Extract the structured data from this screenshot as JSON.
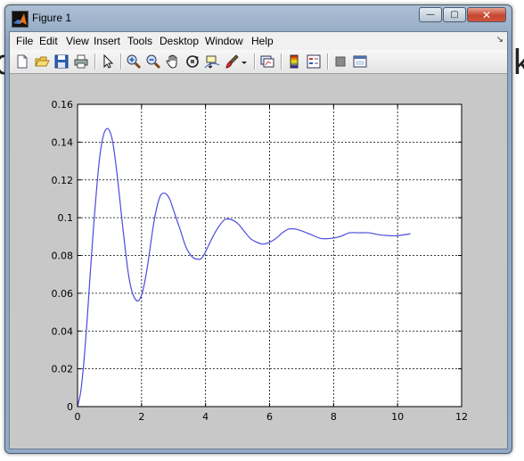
{
  "background": {
    "left_glyph": "c",
    "right_glyph": "k"
  },
  "window": {
    "title": "Figure 1",
    "controls": {
      "minimize": "—",
      "maximize": "▢",
      "close": "✕"
    }
  },
  "menu": [
    {
      "label": "File"
    },
    {
      "label": "Edit"
    },
    {
      "label": "View"
    },
    {
      "label": "Insert"
    },
    {
      "label": "Tools"
    },
    {
      "label": "Desktop"
    },
    {
      "label": "Window"
    },
    {
      "label": "Help"
    }
  ],
  "menu_arrow": "↘",
  "toolbar_icons": [
    "new-figure-icon",
    "open-file-icon",
    "save-icon",
    "print-icon",
    "edit-plot-arrow-icon",
    "zoom-in-icon",
    "zoom-out-icon",
    "pan-hand-icon",
    "rotate-3d-icon",
    "data-cursor-icon",
    "brush-icon",
    "brush-dropdown-icon",
    "link-plot-icon",
    "colorbar-icon",
    "legend-icon",
    "hide-plot-tools-icon",
    "show-plot-tools-icon"
  ],
  "colors": {
    "line": "#4b4bdc",
    "axes_bg": "#ffffff",
    "figure_bg": "#c8c8c8",
    "grid": "#000000"
  },
  "chart_data": {
    "type": "line",
    "title": "",
    "xlabel": "",
    "ylabel": "",
    "xlim": [
      0,
      12
    ],
    "ylim": [
      0,
      0.16
    ],
    "xticks": [
      0,
      2,
      4,
      6,
      8,
      10,
      12
    ],
    "yticks": [
      0,
      0.02,
      0.04,
      0.06,
      0.08,
      0.1,
      0.12,
      0.14,
      0.16
    ],
    "xtick_labels": [
      "0",
      "2",
      "4",
      "6",
      "8",
      "10",
      "12"
    ],
    "ytick_labels": [
      "0",
      "0.02",
      "0.04",
      "0.06",
      "0.08",
      "0.1",
      "0.12",
      "0.14",
      "0.16"
    ],
    "grid": true,
    "grid_style": "dotted",
    "series": [
      {
        "x": [
          0,
          0.1,
          0.2,
          0.3,
          0.4,
          0.5,
          0.6,
          0.7,
          0.8,
          0.9,
          1.0,
          1.1,
          1.2,
          1.3,
          1.4,
          1.5,
          1.6,
          1.7,
          1.8,
          1.9,
          2.0,
          2.1,
          2.2,
          2.3,
          2.4,
          2.5,
          2.6,
          2.7,
          2.8,
          2.9,
          3.0,
          3.2,
          3.4,
          3.6,
          3.8,
          3.9,
          4.0,
          4.2,
          4.4,
          4.6,
          4.8,
          5.0,
          5.2,
          5.4,
          5.6,
          5.8,
          6.0,
          6.2,
          6.4,
          6.6,
          6.8,
          7.0,
          7.3,
          7.6,
          7.9,
          8.2,
          8.5,
          8.8,
          9.1,
          9.4,
          9.7,
          10.0,
          10.4
        ],
        "y": [
          0,
          0.008,
          0.024,
          0.046,
          0.071,
          0.095,
          0.116,
          0.133,
          0.143,
          0.147,
          0.146,
          0.14,
          0.128,
          0.113,
          0.097,
          0.082,
          0.069,
          0.061,
          0.057,
          0.056,
          0.059,
          0.066,
          0.076,
          0.088,
          0.099,
          0.107,
          0.112,
          0.113,
          0.112,
          0.109,
          0.104,
          0.094,
          0.084,
          0.079,
          0.078,
          0.079,
          0.082,
          0.089,
          0.095,
          0.099,
          0.099,
          0.097,
          0.093,
          0.089,
          0.087,
          0.086,
          0.087,
          0.089,
          0.092,
          0.094,
          0.094,
          0.093,
          0.091,
          0.089,
          0.089,
          0.09,
          0.092,
          0.092,
          0.092,
          0.091,
          0.0905,
          0.0905,
          0.0915
        ]
      }
    ]
  }
}
